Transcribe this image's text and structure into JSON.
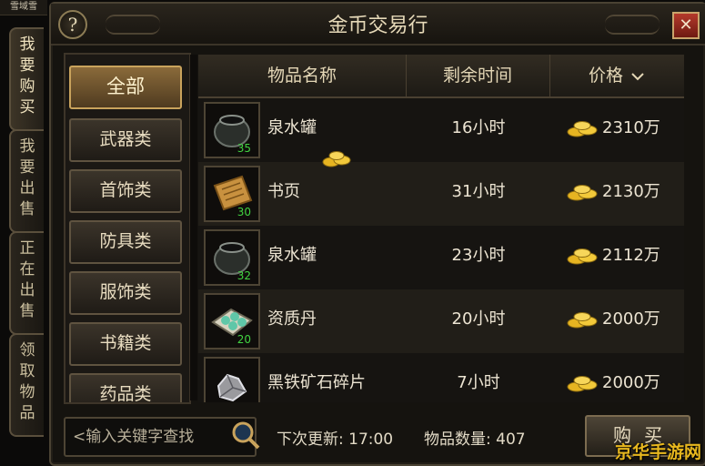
{
  "corner_label": "雪域雪",
  "window": {
    "title": "金币交易行",
    "help_label": "?",
    "close_label": "✕"
  },
  "side_tabs": [
    {
      "label": "我要购买",
      "active": true
    },
    {
      "label": "我要出售",
      "active": false
    },
    {
      "label": "正在出售",
      "active": false
    },
    {
      "label": "领取物品",
      "active": false
    }
  ],
  "categories": [
    {
      "label": "全部",
      "active": true
    },
    {
      "label": "武器类",
      "active": false
    },
    {
      "label": "首饰类",
      "active": false
    },
    {
      "label": "防具类",
      "active": false
    },
    {
      "label": "服饰类",
      "active": false
    },
    {
      "label": "书籍类",
      "active": false
    },
    {
      "label": "药品类",
      "active": false
    }
  ],
  "table": {
    "headers": {
      "name": "物品名称",
      "time": "剩余时间",
      "price": "价格",
      "sort_icon": "chevron-down-icon"
    },
    "rows": [
      {
        "icon": "pot-icon",
        "qty": "35",
        "name": "泉水罐",
        "time": "16小时",
        "price": "2310万"
      },
      {
        "icon": "scroll-page-icon",
        "qty": "30",
        "name": "书页",
        "time": "31小时",
        "price": "2130万"
      },
      {
        "icon": "pot-icon",
        "qty": "32",
        "name": "泉水罐",
        "time": "23小时",
        "price": "2112万"
      },
      {
        "icon": "pill-box-icon",
        "qty": "20",
        "name": "资质丹",
        "time": "20小时",
        "price": "2000万"
      },
      {
        "icon": "ore-fragment-icon",
        "qty": "",
        "name": "黑铁矿石碎片",
        "time": "7小时",
        "price": "2000万"
      }
    ]
  },
  "footer": {
    "search_placeholder": "<输入关键字查找",
    "next_update": "下次更新: 17:00",
    "item_count": "物品数量: 407",
    "buy_label": "购买"
  },
  "watermark": "京华手游网",
  "colors": {
    "accent_gold": "#e7b71e",
    "close_red": "#b43a2c",
    "qty_green": "#41d341"
  }
}
